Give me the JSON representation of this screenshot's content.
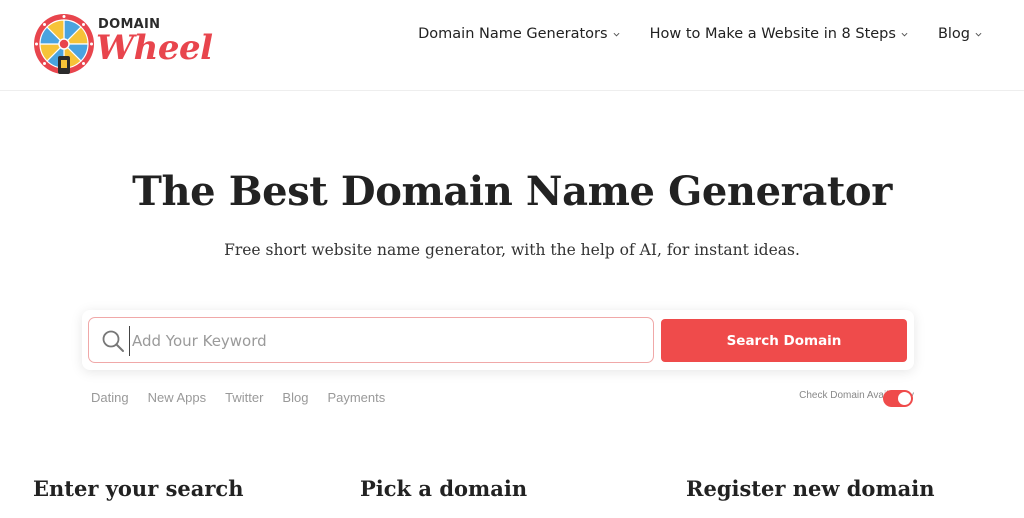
{
  "header": {
    "logo": {
      "top_text": "DOMAIN",
      "script_text": "Wheel"
    },
    "nav": [
      {
        "label": "Domain Name Generators",
        "icon": "chevron-down-icon"
      },
      {
        "label": "How to Make a Website in 8 Steps",
        "icon": "chevron-down-icon"
      },
      {
        "label": "Blog",
        "icon": "chevron-down-icon"
      }
    ]
  },
  "hero": {
    "title": "The Best Domain Name Generator",
    "subtitle": "Free short website name generator, with the help of AI, for instant ideas."
  },
  "search": {
    "placeholder": "Add Your Keyword",
    "value": "",
    "button_label": "Search Domain",
    "icon": "search-icon"
  },
  "tags": [
    "Dating",
    "New Apps",
    "Twitter",
    "Blog",
    "Payments"
  ],
  "availability": {
    "label": "Check Domain Availability",
    "enabled": true
  },
  "steps": [
    {
      "title": "Enter your search"
    },
    {
      "title": "Pick a domain"
    },
    {
      "title": "Register new domain"
    }
  ],
  "colors": {
    "accent": "#ef4b4b",
    "text": "#222222",
    "muted": "#999999"
  }
}
